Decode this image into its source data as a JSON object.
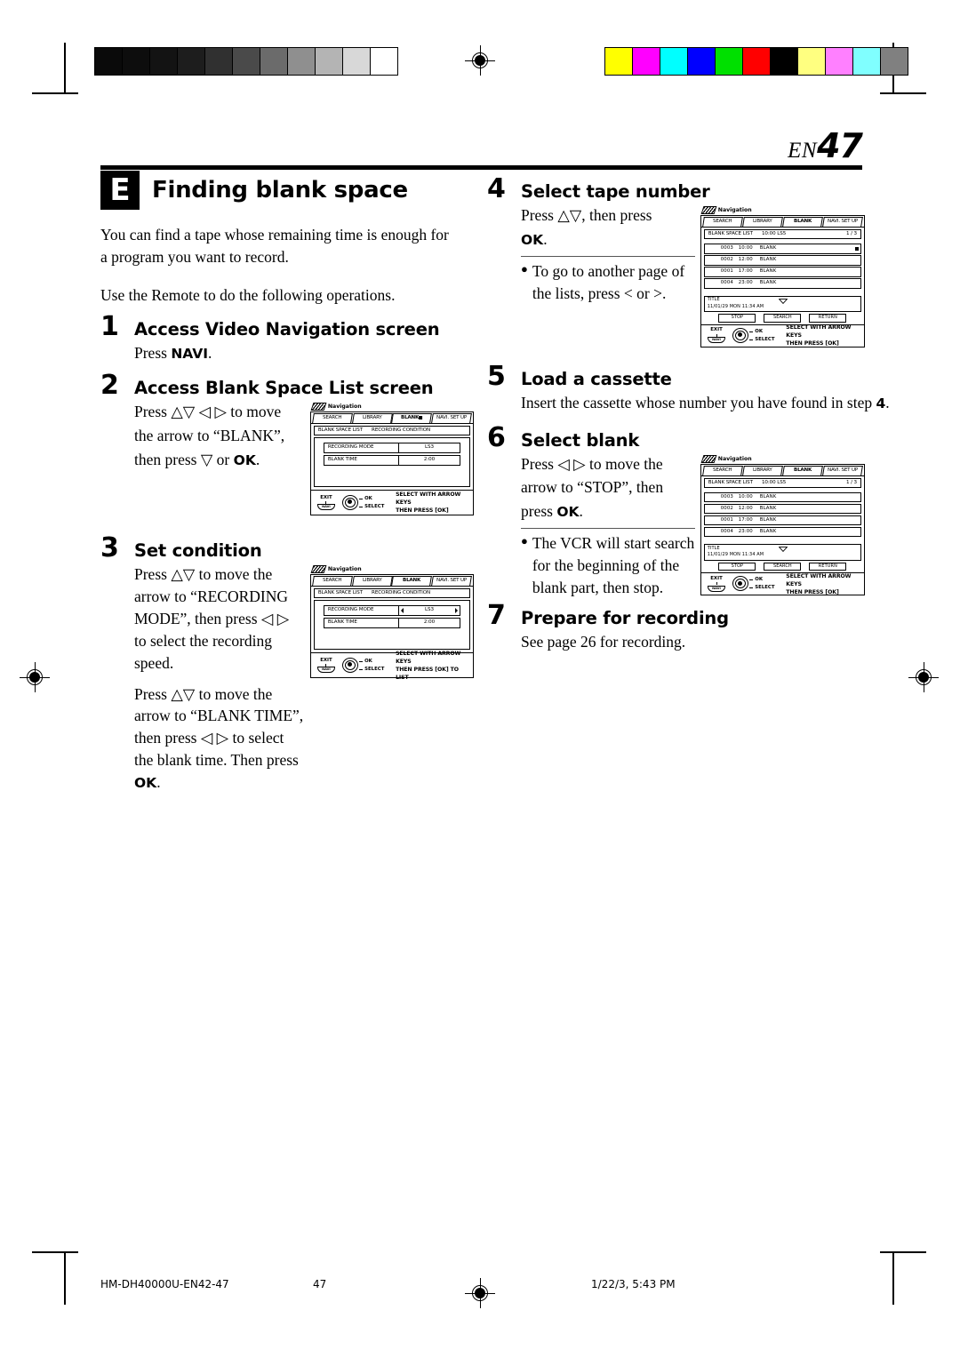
{
  "page": {
    "header_lang": "EN",
    "header_number": "47"
  },
  "section": {
    "badge": "E",
    "title": "Finding blank space",
    "intro": "You can find a tape whose remaining time is enough for a program you want to record.",
    "intro2": "Use the Remote to do the following operations."
  },
  "steps": [
    {
      "num": "1",
      "title": "Access Video Navigation screen",
      "body_pre": "Press ",
      "body_bold": "NAVI",
      "body_post": "."
    },
    {
      "num": "2",
      "title": "Access Blank Space List screen",
      "line1": "Press △▽ ◁ ▷ to move",
      "line2": "the arrow to “BLANK”,",
      "line3_pre": "then press ▽ or ",
      "line3_bold": "OK",
      "line3_post": "."
    },
    {
      "num": "3",
      "title": "Set condition",
      "p1": "Press △▽ to move the arrow to “RECORDING MODE”, then press ◁ ▷ to select the recording speed.",
      "p2_pre": "Press △▽ to move the arrow to “BLANK TIME”, then press ◁ ▷ to select the blank time. Then press ",
      "p2_bold": "OK",
      "p2_post": "."
    },
    {
      "num": "4",
      "title": "Select tape number",
      "line1": "Press △▽, then press",
      "line2_bold": "OK",
      "line2_post": ".",
      "note": "To go to another page of the lists, press < or >."
    },
    {
      "num": "5",
      "title": "Load a cassette",
      "body_pre": "Insert the cassette whose number you have found in step ",
      "body_bold": "4",
      "body_post": "."
    },
    {
      "num": "6",
      "title": "Select blank",
      "line1": "Press ◁ ▷ to move the",
      "line2": "arrow to “STOP”, then",
      "line3_pre": "press ",
      "line3_bold": "OK",
      "line3_post": ".",
      "note": "The VCR will start search for the beginning of the blank part, then stop."
    },
    {
      "num": "7",
      "title": "Prepare for recording",
      "body": "See page 26  for recording."
    }
  ],
  "osd_common": {
    "window_title": "Navigation",
    "tabs": [
      "SEARCH",
      "LIBRARY",
      "BLANK",
      "NAVI. SET UP"
    ],
    "active_tab": "BLANK",
    "exit_label": "EXIT",
    "navi_button": "NAVI",
    "ok_label": "OK",
    "select_label": "SELECT",
    "msg_line1": "SELECT WITH ARROW KEYS",
    "msg_line2": "THEN PRESS [OK]",
    "msg_line2_to_list": "THEN PRESS [OK] TO LIST"
  },
  "osd_condition": {
    "header_left": "BLANK SPACE LIST",
    "header_right": "RECORDING CONDITION",
    "rows": [
      {
        "label": "RECORDING MODE",
        "value": "LS3"
      },
      {
        "label": "BLANK TIME",
        "value": "2:00"
      }
    ]
  },
  "osd_list": {
    "header_left": "BLANK SPACE LIST",
    "header_mid": "10:00 LS5",
    "header_right": "1 / 3",
    "rows": [
      {
        "no": "0003",
        "time": "10:00",
        "state": "BLANK"
      },
      {
        "no": "0002",
        "time": "12:00",
        "state": "BLANK"
      },
      {
        "no": "0001",
        "time": "17:00",
        "state": "BLANK"
      },
      {
        "no": "0004",
        "time": "23:00",
        "state": "BLANK"
      }
    ],
    "title_label": "TITLE",
    "title_value": "11/01/29   MON   11:34 AM",
    "buttons": [
      "STOP",
      "SEARCH",
      "RETURN"
    ]
  },
  "footer": {
    "doc_id": "HM-DH40000U-EN42-47",
    "page": "47",
    "timestamp": "1/22/3, 5:43 PM"
  },
  "color_bars": {
    "gray": [
      "#0a0a0a",
      "#0d0d0d",
      "#131313",
      "#1d1d1d",
      "#303030",
      "#4a4a4a",
      "#6b6b6b",
      "#8f8f8f",
      "#b4b4b4",
      "#d8d8d8",
      "#ffffff"
    ],
    "color": [
      "#ffff00",
      "#ff00ff",
      "#00ffff",
      "#0000ff",
      "#00e000",
      "#ff0000",
      "#000000",
      "#ffff80",
      "#ff80ff",
      "#80ffff",
      "#808080"
    ]
  }
}
